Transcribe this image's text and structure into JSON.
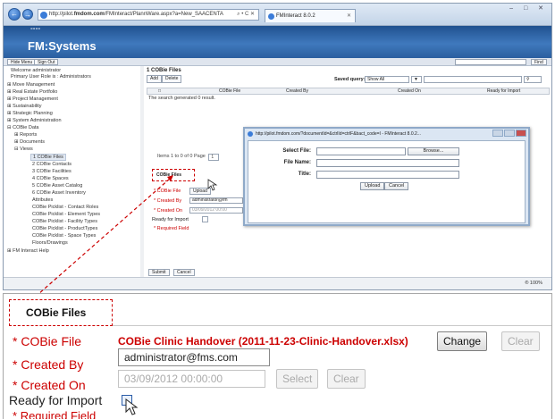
{
  "browser": {
    "back_icon": "back-arrow-icon",
    "forward_icon": "forward-arrow-icon",
    "url_prefix": "http://pilot.",
    "url_domain": "fmdom.com",
    "url_rest": "/FMInteract/PlannWare.aspx?a=New_SAACENTA",
    "url_tools": "⌕ • C ✕",
    "tab_label": "FMInteract 8.0.2",
    "tab_close": "✕",
    "window_controls": "– □ ✕"
  },
  "app": {
    "logo_dots": "°°°°",
    "logo_text": "FM:Systems",
    "hide_menu": "Hide Menu",
    "sign_out": "Sign Out",
    "find": "Find"
  },
  "sidebar": {
    "welcome": "Welcome administrator",
    "role": "Primary User Role is : Administrators",
    "items": [
      "Move Management",
      "Real Estate Portfolio",
      "Project Management",
      "Sustainability",
      "Strategic Planning",
      "System Administration",
      "COBie Data",
      "Reports",
      "Documents",
      "Views",
      "1 COBie Files",
      "2 COBie Contacts",
      "3 COBie Facilities",
      "4 COBie Spaces",
      "5 COBie Asset Catalog",
      "6 COBie Asset Inventory",
      "Attributes",
      "COBie Picklist - Contact Roles",
      "COBie Picklist - Element Types",
      "COBie Picklist - Facility Types",
      "COBie Picklist - ProductTypes",
      "COBie Picklist - Space Types",
      "Floors/Drawings",
      "FM Interact Help"
    ]
  },
  "content": {
    "title": "1 COBie Files",
    "add": "Add",
    "delete": "Delete",
    "saved_query_label": "Saved query:",
    "saved_query_value": "Show All",
    "columns": [
      "COBie File",
      "Created By",
      "Created On",
      "Ready for Import"
    ],
    "result_message": "The search generated 0 result.",
    "pager": "Items 1 to 0 of 0    Page",
    "pager_value": "1",
    "form_tab": "COBie Files",
    "form_fields": {
      "cobie_file": "* COBie File",
      "created_by": "* Created By",
      "created_on": "* Created On",
      "ready_for_import": "Ready for Import",
      "required": "* Required Field"
    },
    "upload": "Upload",
    "created_by_value": "administrator@fm",
    "created_on_value": "03/09/2012 00:00",
    "submit": "Submit",
    "cancel": "Cancel",
    "zoom": "® 100%"
  },
  "popup": {
    "title": "http://pilot.fmdom.com/?documentId=&ctrlId=ctrlF&bact_code=I - FMInteract 8.0.2...",
    "select_file": "Select File:",
    "browse": "Browse...",
    "file_name": "File Name:",
    "title_label": "Title:",
    "upload": "Upload",
    "cancel": "Cancel"
  },
  "zoomed": {
    "tab": "COBie Files",
    "cobie_file_label": "COBie File",
    "cobie_file_value": "COBie Clinic Handover (2011-11-23-Clinic-Handover.xlsx)",
    "change": "Change",
    "clear": "Clear",
    "created_by_label": "Created By",
    "created_by_value": "administrator@fms.com",
    "created_on_label": "Created On",
    "created_on_value": "03/09/2012 00:00:00",
    "select": "Select",
    "ready_for_import_label": "Ready for Import",
    "required_label": "Required Field",
    "asterisk": "*"
  },
  "colors": {
    "required_red": "#cc0000",
    "header_blue": "#2b5f9f",
    "arrow_red": "#cc0000"
  }
}
